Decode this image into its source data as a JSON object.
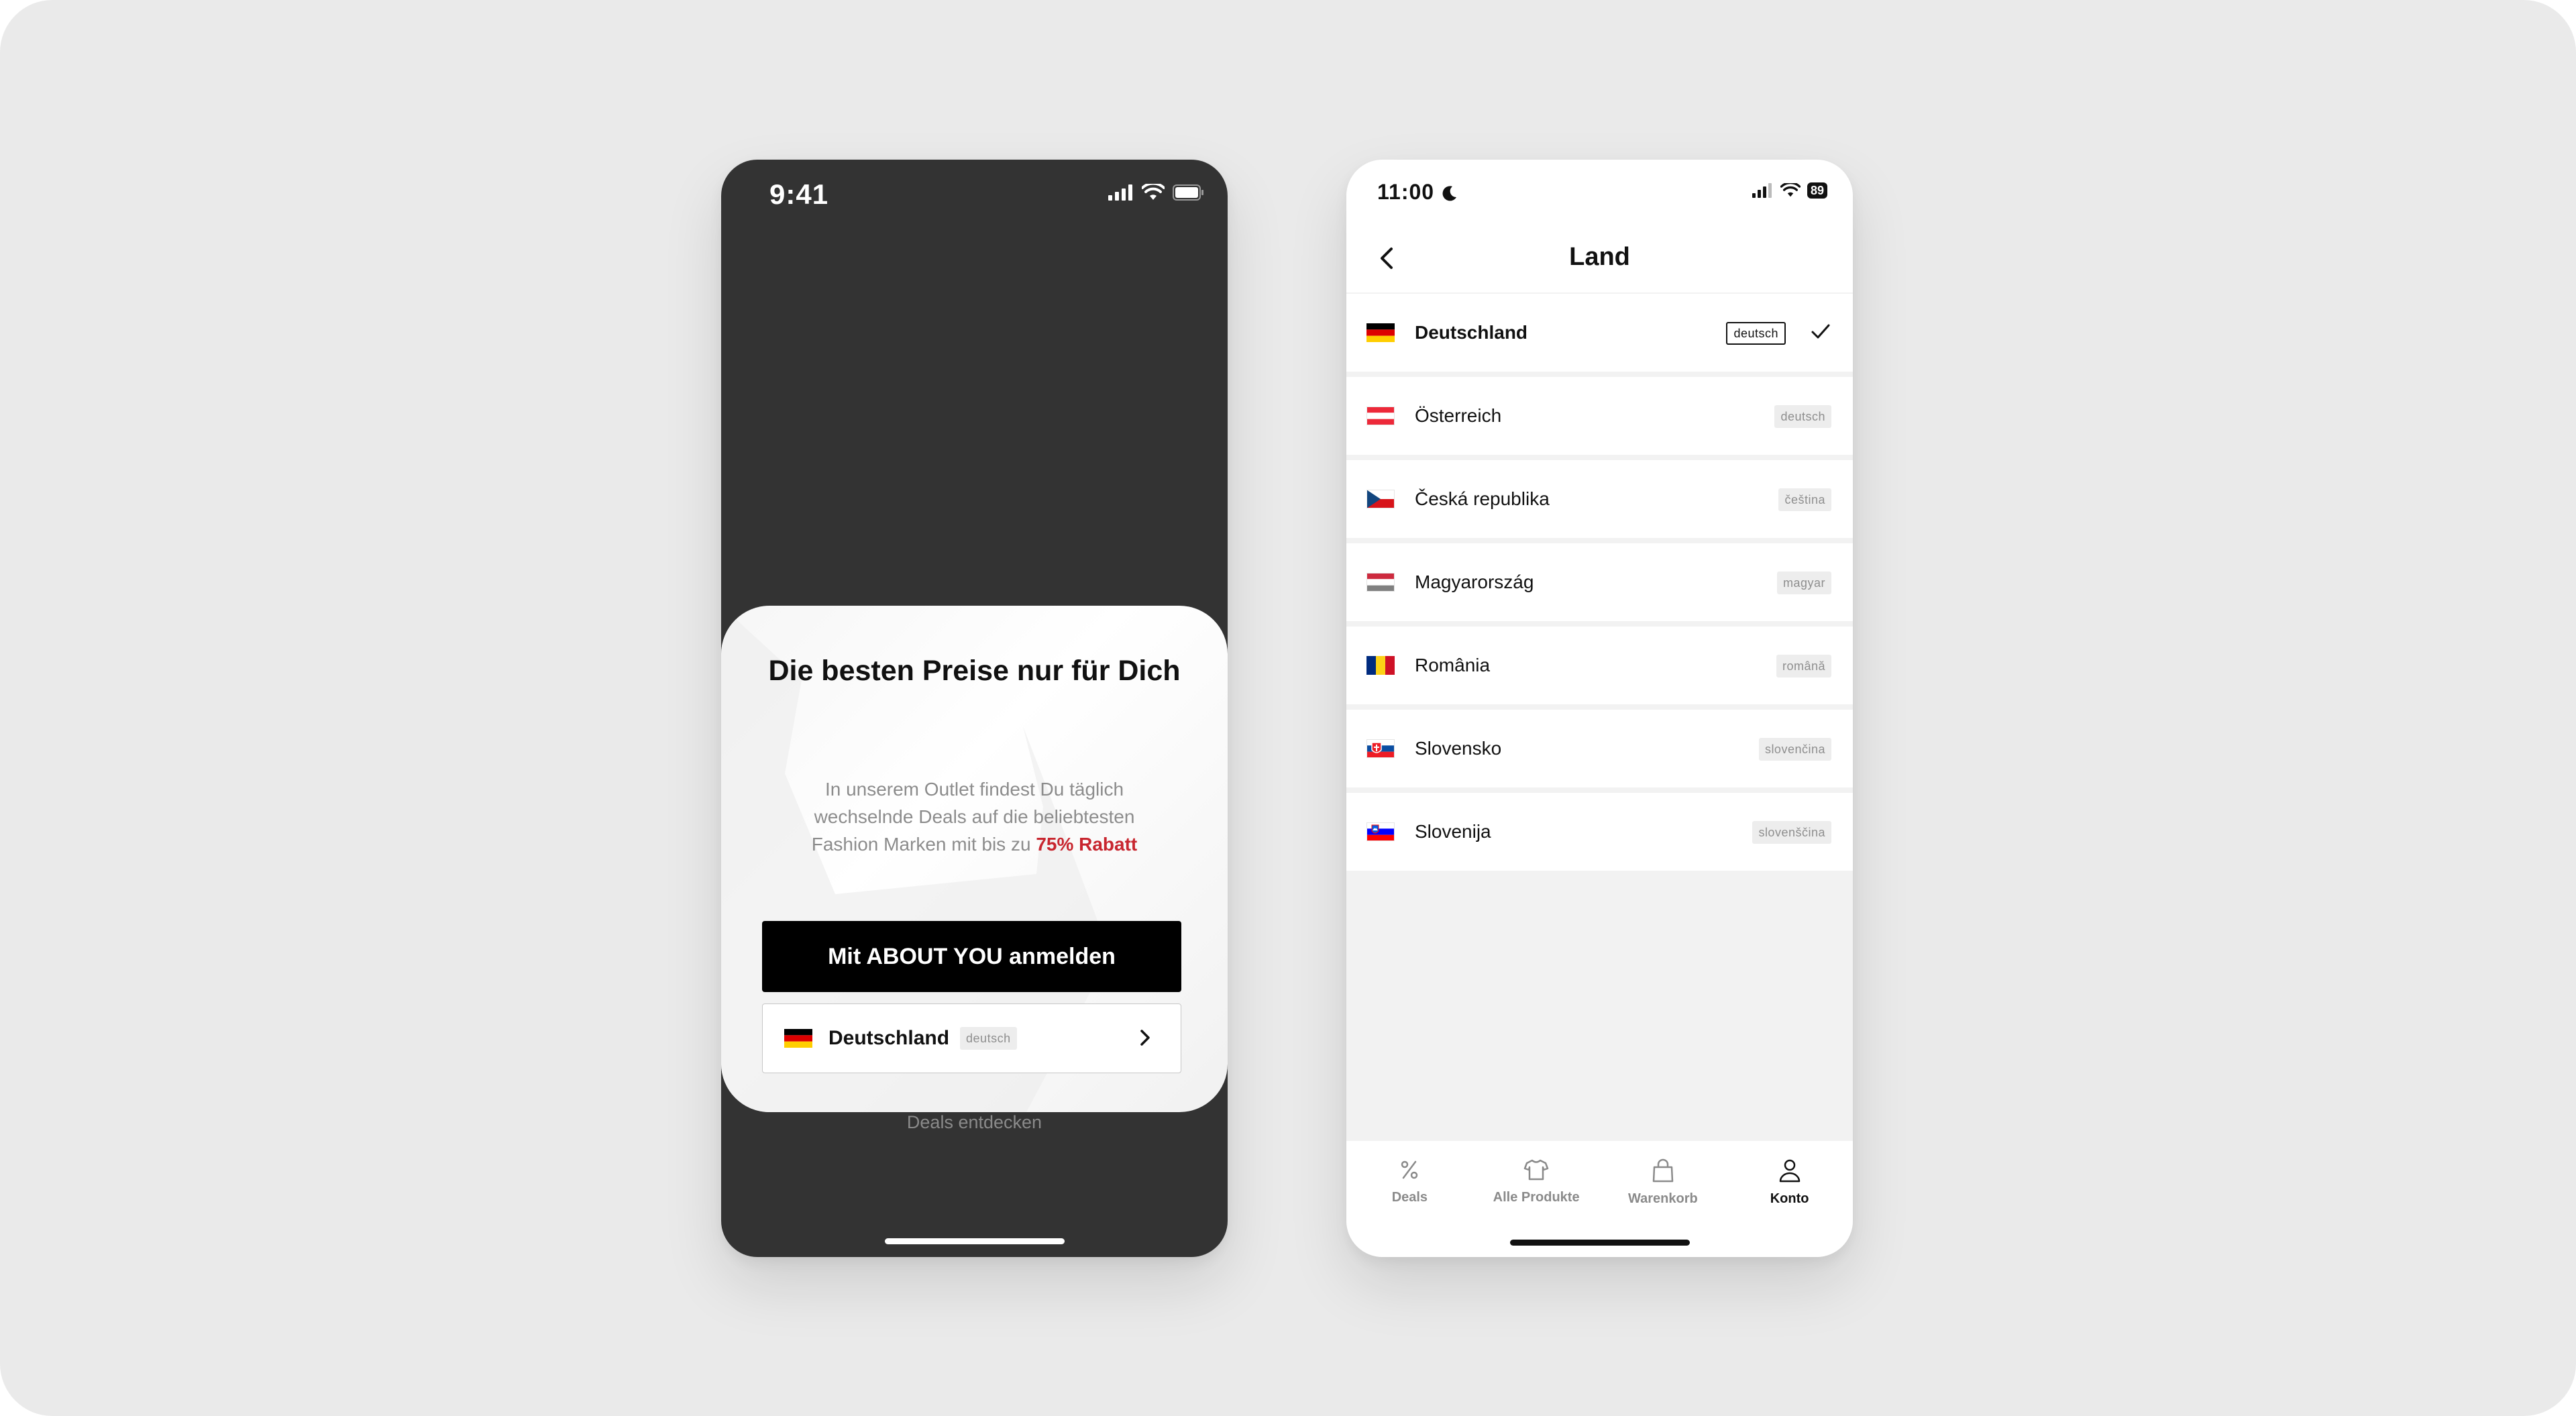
{
  "left_screen": {
    "status_time": "9:41",
    "modal": {
      "title": "Die besten Preise nur für Dich",
      "description_text": "In unserem Outlet findest Du täglich wechselnde Deals auf die beliebtesten Fashion Marken mit bis zu",
      "description_highlight": "75% Rabatt",
      "highlight_color": "#c8262f",
      "login_button": "Mit ABOUT YOU anmelden",
      "country_selector": {
        "flag": "flag-de",
        "country": "Deutschland",
        "language": "deutsch"
      }
    },
    "deals_link": "Deals entdecken"
  },
  "right_screen": {
    "status_time": "11:00",
    "battery": "89",
    "title": "Land",
    "countries": [
      {
        "name": "Deutschland",
        "language": "deutsch",
        "flag": "flag-de",
        "selected": true
      },
      {
        "name": "Österreich",
        "language": "deutsch",
        "flag": "flag-at",
        "selected": false
      },
      {
        "name": "Česká republika",
        "language": "čeština",
        "flag": "flag-cz",
        "selected": false
      },
      {
        "name": "Magyarország",
        "language": "magyar",
        "flag": "flag-hu",
        "selected": false
      },
      {
        "name": "România",
        "language": "română",
        "flag": "flag-ro",
        "selected": false
      },
      {
        "name": "Slovensko",
        "language": "slovenčina",
        "flag": "flag-sk",
        "selected": false
      },
      {
        "name": "Slovenija",
        "language": "slovenščina",
        "flag": "flag-si",
        "selected": false
      }
    ],
    "tabs": [
      {
        "label": "Deals",
        "icon": "percent-icon",
        "active": false
      },
      {
        "label": "Alle Produkte",
        "icon": "shirt-icon",
        "active": false
      },
      {
        "label": "Warenkorb",
        "icon": "shopping-bag-icon",
        "active": false
      },
      {
        "label": "Konto",
        "icon": "user-icon",
        "active": true
      }
    ]
  },
  "colors": {
    "background": "#eaeaea",
    "dark_phone": "#333333",
    "primary_button": "#000000",
    "accent_red": "#c8262f"
  }
}
